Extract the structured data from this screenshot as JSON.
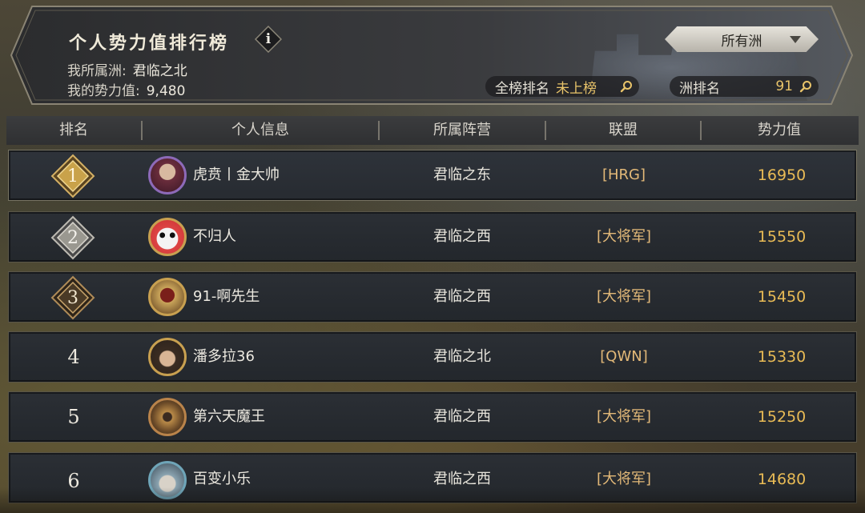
{
  "header": {
    "title": "个人势力值排行榜",
    "info_label": "i",
    "continent_label": "我所属洲:",
    "continent_value": "君临之北",
    "power_label": "我的势力值:",
    "power_value": "9,480",
    "filter_selected": "所有洲",
    "global_rank_label": "全榜排名",
    "global_rank_value": "未上榜",
    "continent_rank_label": "洲排名",
    "continent_rank_value": "91"
  },
  "table": {
    "columns": [
      "排名",
      "个人信息",
      "所属阵营",
      "联盟",
      "势力值"
    ],
    "rows": [
      {
        "rank": "1",
        "name": "虎贲丨金大帅",
        "camp": "君临之东",
        "alliance": "[HRG]",
        "power": "16950"
      },
      {
        "rank": "2",
        "name": "不归人",
        "camp": "君临之西",
        "alliance": "[大将军]",
        "power": "15550"
      },
      {
        "rank": "3",
        "name": "91-啊先生",
        "camp": "君临之西",
        "alliance": "[大将军]",
        "power": "15450"
      },
      {
        "rank": "4",
        "name": "潘多拉36",
        "camp": "君临之北",
        "alliance": "[QWN]",
        "power": "15330"
      },
      {
        "rank": "5",
        "name": "第六天魔王",
        "camp": "君临之西",
        "alliance": "[大将军]",
        "power": "15250"
      },
      {
        "rank": "6",
        "name": "百变小乐",
        "camp": "君临之西",
        "alliance": "[大将军]",
        "power": "14680"
      }
    ]
  },
  "colors": {
    "gold": "#e9bb55",
    "alliance": "#e3b978",
    "rank1": "#c9a24a",
    "rank2": "#9a9890",
    "rank3": "#6b5536"
  },
  "icons": {
    "info": "info-icon",
    "dropdown": "chevron-down-icon",
    "search": "search-icon"
  }
}
